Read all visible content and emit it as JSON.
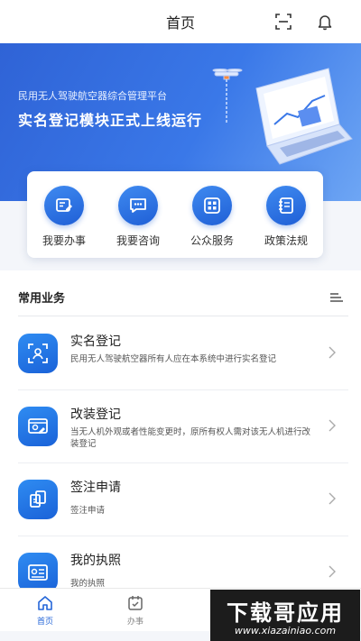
{
  "header": {
    "title": "首页"
  },
  "banner": {
    "subtitle": "民用无人驾驶航空器综合管理平台",
    "headline": "实名登记模块正式上线运行"
  },
  "quick_actions": [
    {
      "label": "我要办事",
      "icon": "edit-doc-icon"
    },
    {
      "label": "我要咨询",
      "icon": "chat-icon"
    },
    {
      "label": "公众服务",
      "icon": "grid-icon"
    },
    {
      "label": "政策法规",
      "icon": "notebook-icon"
    }
  ],
  "services": {
    "title": "常用业务",
    "items": [
      {
        "title": "实名登记",
        "desc": "民用无人驾驶航空器所有人应在本系统中进行实名登记",
        "icon": "user-scan-icon"
      },
      {
        "title": "改装登记",
        "desc": "当无人机外观或者性能变更时，原所有权人需对该无人机进行改装登记",
        "icon": "id-card-edit-icon"
      },
      {
        "title": "签注申请",
        "desc": "签注申请",
        "icon": "clipboard-icon"
      },
      {
        "title": "我的执照",
        "desc": "我的执照",
        "icon": "license-icon"
      }
    ]
  },
  "tabbar": {
    "tabs": [
      {
        "label": "首页",
        "icon": "home-icon",
        "active": true
      },
      {
        "label": "办事",
        "icon": "checklist-icon",
        "active": false
      },
      {
        "label": "",
        "icon": "monitor-icon",
        "active": false
      },
      {
        "label": "",
        "icon": "user-icon",
        "active": false
      }
    ]
  },
  "watermark": {
    "line1": "下载哥应用",
    "line2": "www.xiazainiao.com"
  },
  "colors": {
    "primary": "#2466d8",
    "banner": "#3a78e8"
  }
}
